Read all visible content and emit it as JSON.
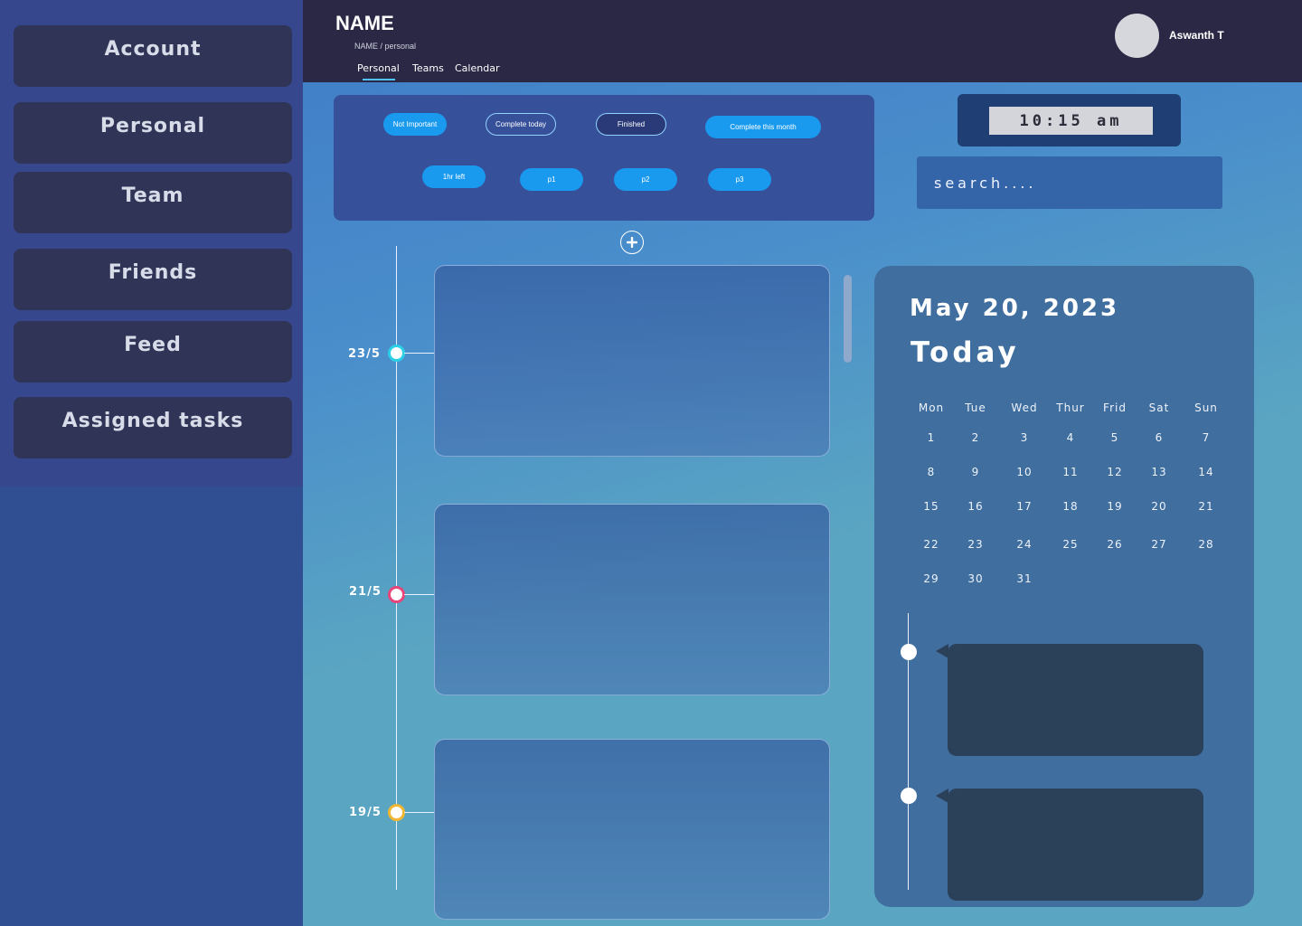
{
  "sidebar": {
    "items": [
      {
        "label": "Account"
      },
      {
        "label": "Personal"
      },
      {
        "label": "Team"
      },
      {
        "label": "Friends"
      },
      {
        "label": "Feed"
      },
      {
        "label": "Assigned tasks"
      }
    ]
  },
  "header": {
    "title": "NAME",
    "breadcrumb": "NAME / personal",
    "tabs": [
      {
        "label": "Personal",
        "active": true
      },
      {
        "label": "Teams"
      },
      {
        "label": "Calendar"
      }
    ],
    "user_name": "Aswanth T"
  },
  "filters": {
    "chips": [
      {
        "label": "Not Important"
      },
      {
        "label": "Complete today"
      },
      {
        "label": "Finished"
      },
      {
        "label": "Complete this month"
      },
      {
        "label": "1hr left"
      },
      {
        "label": "p1"
      },
      {
        "label": "p2"
      },
      {
        "label": "p3"
      }
    ]
  },
  "clock": {
    "time": "10:15 am"
  },
  "search": {
    "placeholder": "search...."
  },
  "timeline": {
    "dates": [
      {
        "label": "23/5",
        "color": "#2ad0e6"
      },
      {
        "label": "21/5",
        "color": "#e8457a"
      },
      {
        "label": "19/5",
        "color": "#f2b632"
      }
    ]
  },
  "calendar": {
    "date": "May 20, 2023",
    "today_label": "Today",
    "weekdays": [
      "Mon",
      "Tue",
      "Wed",
      "Thur",
      "Frid",
      "Sat",
      "Sun"
    ],
    "days": [
      "1",
      "2",
      "3",
      "4",
      "5",
      "6",
      "7",
      "8",
      "9",
      "10",
      "11",
      "12",
      "13",
      "14",
      "15",
      "16",
      "17",
      "18",
      "19",
      "20",
      "21",
      "22",
      "23",
      "24",
      "25",
      "26",
      "27",
      "28",
      "29",
      "30",
      "31"
    ]
  }
}
